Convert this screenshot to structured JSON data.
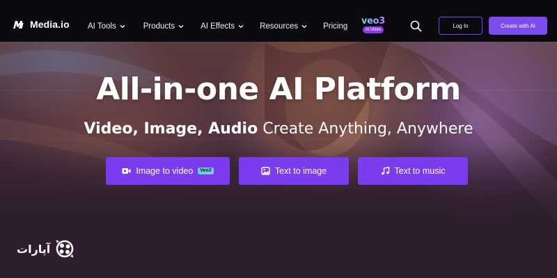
{
  "header": {
    "brand": "Media.io",
    "menu": [
      {
        "label": "AI Tools",
        "has_dropdown": true
      },
      {
        "label": "Products",
        "has_dropdown": true
      },
      {
        "label": "AI Effects",
        "has_dropdown": true
      },
      {
        "label": "Resources",
        "has_dropdown": true
      },
      {
        "label": "Pricing",
        "has_dropdown": false
      }
    ],
    "veo_logo_text": "veo3",
    "veo_badge": "AI Video",
    "search_icon": "search-icon",
    "login_label": "Log In",
    "create_label": "Create with AI"
  },
  "hero": {
    "title": "All-in-one AI Platform",
    "subtitle_bold": "Video, Image, Audio",
    "subtitle_rest": " Create Anything, Anywhere",
    "buttons": [
      {
        "label": "Image to video",
        "icon": "video-icon",
        "badge": "Veo3"
      },
      {
        "label": "Text to image",
        "icon": "image-icon"
      },
      {
        "label": "Text to music",
        "icon": "music-note-icon"
      }
    ]
  },
  "watermark": {
    "text": "آپارات",
    "icon": "aparat-logo-icon"
  },
  "colors": {
    "nav_bg": "#0b0b0f",
    "accent": "#7b3cf0",
    "login_border": "#6a4cf0"
  }
}
